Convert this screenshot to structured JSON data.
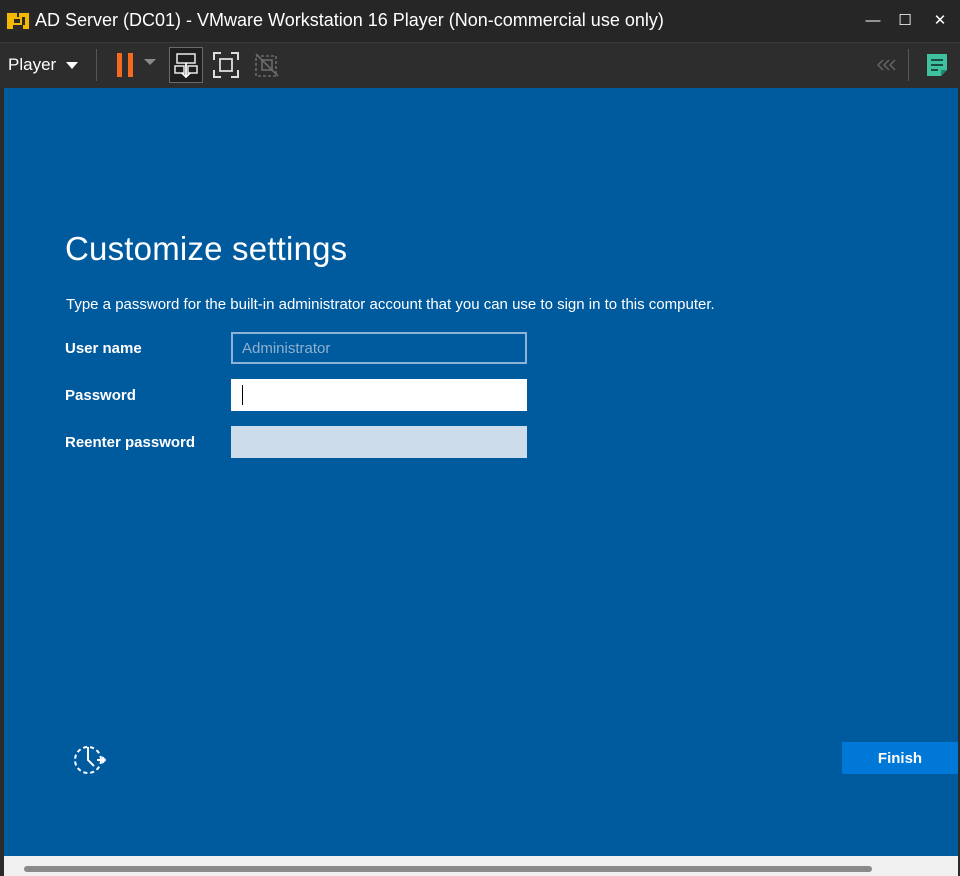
{
  "window": {
    "title": "AD Server (DC01) - VMware Workstation 16 Player (Non-commercial use only)",
    "controls": {
      "minimize": "—",
      "maximize": "☐",
      "close": "✕"
    }
  },
  "toolbar": {
    "player_menu_label": "Player",
    "icons": [
      "pause-icon",
      "send-ctrl-alt-del-icon",
      "full-screen-icon",
      "unity-icon",
      "collapse-icon",
      "notes-icon"
    ],
    "accent_color": "#f26b21"
  },
  "setup": {
    "title": "Customize settings",
    "instructions": "Type a password for the built-in administrator account that you can use to sign in to this computer.",
    "fields": {
      "username": {
        "label": "User name",
        "placeholder": "Administrator",
        "value": ""
      },
      "password": {
        "label": "Password",
        "value": ""
      },
      "reenter": {
        "label": "Reenter password",
        "value": ""
      }
    },
    "finish_label": "Finish",
    "background_color": "#005a9e",
    "button_color": "#0078d7"
  }
}
